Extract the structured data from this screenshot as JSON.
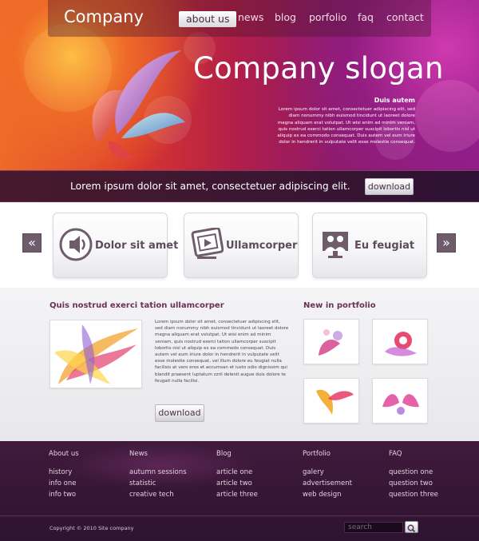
{
  "header": {
    "brand": "Company",
    "nav": [
      {
        "label": "about us",
        "active": true
      },
      {
        "label": "news",
        "active": false
      },
      {
        "label": "blog",
        "active": false
      },
      {
        "label": "porfolio",
        "active": false
      },
      {
        "label": "faq",
        "active": false
      },
      {
        "label": "contact",
        "active": false
      }
    ]
  },
  "hero": {
    "slogan": "Company slogan",
    "subtitle": "Duis autem",
    "text": "Lorem ipsum dolor sit amet, consectetuer adipiscing elit, sed diam nonummy nibh euismod tincidunt ut laoreet dolore magna aliquam erat volutpat. Ut wisi enim ad minim veniam, quis nostrud exerci tation ullamcorper suscipit lobortis nisl ut aliquip ex ea commodo consequat. Duis autem vel eum iriure dolor in hendrerit in vulputate velit esse molestie consequat."
  },
  "banner": {
    "text": "Lorem ipsum dolor sit amet, consectetuer adipiscing elit.",
    "button": "download"
  },
  "features": {
    "prev": "«",
    "next": "»",
    "cards": [
      {
        "label": "Dolor sit amet",
        "icon": "speaker-icon"
      },
      {
        "label": "Ullamcorper",
        "icon": "video-play-icon"
      },
      {
        "label": "Eu feugiat",
        "icon": "users-screen-icon"
      }
    ]
  },
  "main": {
    "title": "Quis nostrud exerci tation ullamcorper",
    "text": "Lorem ipsum dolor sit amet, consectetuer adipiscing elit, sed diam nonummy nibh euismod tincidunt ut laoreet dolore magna aliquam erat volutpat. Ut wisi enim ad minim veniam, quis nostrud exerci tation ullamcorper suscipit lobortis nisl ut aliquip ex ea commodo consequat. Duis autem vel eum iriure dolor in hendrerit in vulputate velit esse molestie consequat, vel illum dolore eu feugiat nulla facilisis at vero eros et accumsan et iusto odio dignissim qui blandit praesent luptatum zzril delenit augue duis dolore te feugait nulla facilisi.",
    "button": "download"
  },
  "portfolio": {
    "title": "New in portfolio"
  },
  "footer": {
    "columns": [
      {
        "heading": "About us",
        "links": [
          "history",
          "info one",
          "info two"
        ]
      },
      {
        "heading": "News",
        "links": [
          "autumn sessions",
          "statistic",
          "creative tech"
        ]
      },
      {
        "heading": "Blog",
        "links": [
          "article one",
          "article two",
          "article three"
        ]
      },
      {
        "heading": "Portfolio",
        "links": [
          "galery",
          "advertisement",
          "web design"
        ]
      },
      {
        "heading": "FAQ",
        "links": [
          "question one",
          "question two",
          "question three"
        ]
      }
    ],
    "copyright": "Copyright © 2010 Site company",
    "search_placeholder": "search"
  },
  "colors": {
    "accent": "#6c2f55",
    "dark_band": "#3c1731",
    "footer_bg": "#2e1330"
  }
}
